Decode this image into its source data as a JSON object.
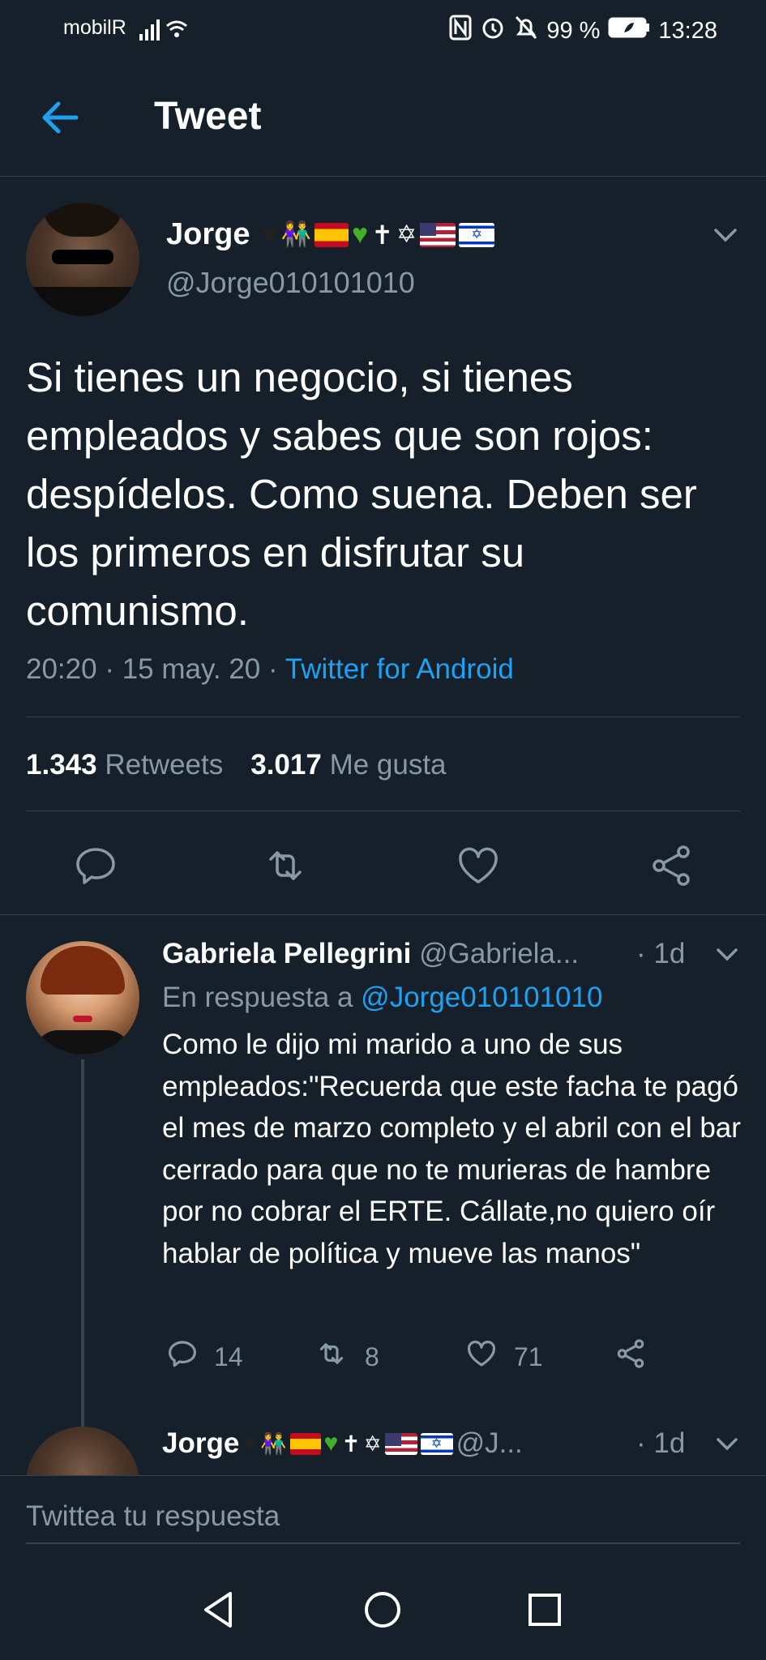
{
  "status_bar": {
    "carrier": "mobilR",
    "battery": "99 %",
    "time": "13:28",
    "icons": [
      "signal-icon",
      "wifi-icon",
      "nfc-icon",
      "alarm-icon",
      "mute-icon",
      "battery-icon"
    ]
  },
  "header": {
    "title": "Tweet"
  },
  "main_tweet": {
    "author_name": "Jorge",
    "author_handle": "@Jorge010101010",
    "text": "Si tienes un negocio, si tienes empleados y sabes que son rojos: despídelos. Como suena. Deben ser los primeros en disfrutar su comunismo.",
    "time": "20:20",
    "date": "15 may. 20",
    "source": "Twitter for Android",
    "retweets_count": "1.343",
    "retweets_label": "Retweets",
    "likes_count": "3.017",
    "likes_label": "Me gusta"
  },
  "reply": {
    "author_name": "Gabriela Pellegrini",
    "author_handle": "@Gabriela...",
    "time": "· 1d",
    "replying_prefix": "En respuesta a",
    "replying_to": "@Jorge010101010",
    "text": "Como le dijo mi marido a uno de sus empleados:\"Recuerda que este facha te pagó el mes de marzo completo y el abril con el bar cerrado para que no te murieras de hambre por no cobrar el ERTE. Cállate,no quiero oír hablar de política y mueve las manos\"",
    "reply_count": "14",
    "retweet_count": "8",
    "like_count": "71"
  },
  "reply2": {
    "author_name": "Jorge",
    "author_handle": "@J...",
    "time": "· 1d"
  },
  "composer": {
    "placeholder": "Twittea tu respuesta"
  },
  "colors": {
    "background": "#15202b",
    "accent": "#1da1f2",
    "muted": "#8899a6",
    "border": "#38444d"
  }
}
